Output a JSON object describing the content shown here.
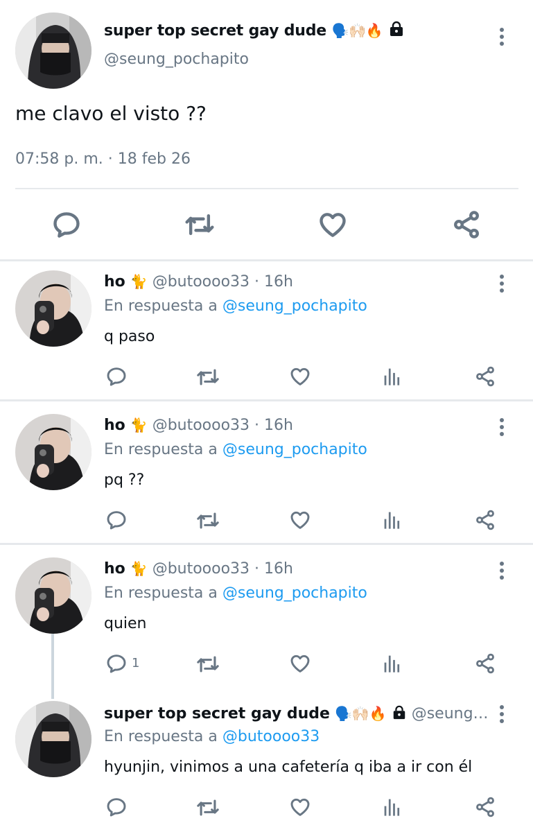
{
  "main": {
    "name": "super top secret gay dude",
    "name_emoji": "🗣️🙌🏻🔥",
    "handle": "@seung_pochapito",
    "text": "me clavo el visto ??",
    "time": "07:58 p. m. · 18 feb 26"
  },
  "replies": [
    {
      "name": "ho",
      "name_emoji": "🐈",
      "meta": "@butoooo33 · 16h",
      "reply_label": "En respuesta a",
      "reply_mention": "@seung_pochapito",
      "text": "q paso",
      "reply_count": ""
    },
    {
      "name": "ho",
      "name_emoji": "🐈",
      "meta": "@butoooo33 · 16h",
      "reply_label": "En respuesta a",
      "reply_mention": "@seung_pochapito",
      "text": "pq ??",
      "reply_count": ""
    },
    {
      "name": "ho",
      "name_emoji": "🐈",
      "meta": "@butoooo33 · 16h",
      "reply_label": "En respuesta a",
      "reply_mention": "@seung_pochapito",
      "text": "quien",
      "reply_count": "1"
    },
    {
      "name": "super top secret gay dude",
      "name_emoji": "🗣️🙌🏻🔥",
      "meta": "@seung…",
      "reply_label": "En respuesta a",
      "reply_mention": "@butoooo33",
      "text": "hyunjin, vinimos a una cafetería q iba a ir con él",
      "reply_count": ""
    }
  ],
  "colors": {
    "text": "#0f1419",
    "muted": "#687684",
    "link": "#1d9bf0",
    "divider": "#e6e9ec"
  },
  "icons": [
    "reply-icon",
    "retweet-icon",
    "like-icon",
    "stats-icon",
    "share-icon",
    "more-icon",
    "lock-icon"
  ]
}
